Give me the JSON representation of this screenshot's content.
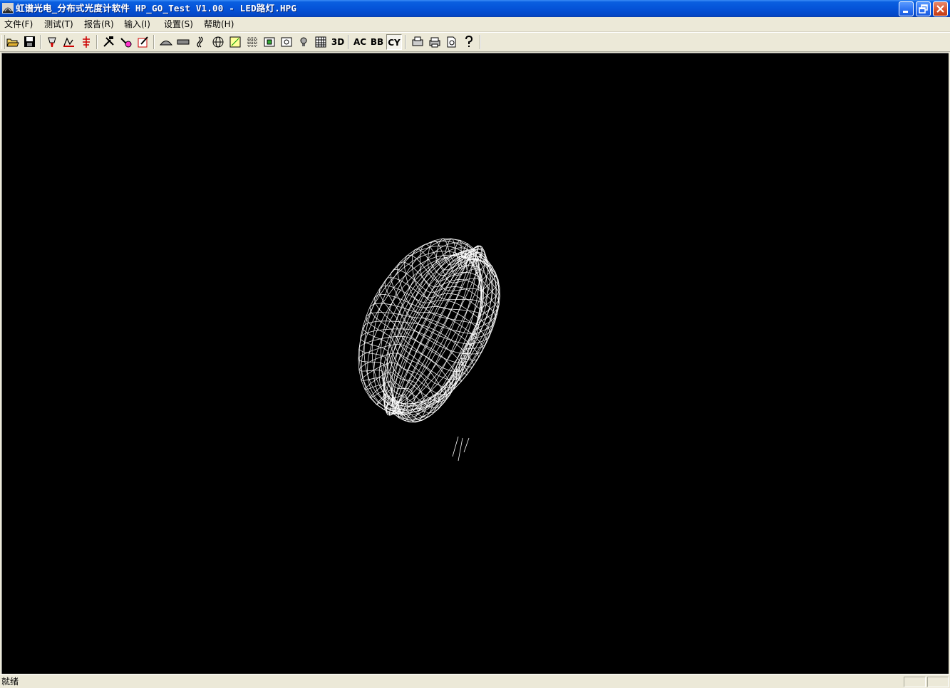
{
  "window": {
    "title": "虹谱光电_分布式光度计软件 HP_GO_Test V1.00 - LED路灯.HPG",
    "app_icon": "photometer-app-icon",
    "controls": [
      "minimize-icon",
      "restore-icon",
      "close-icon"
    ]
  },
  "menu": {
    "items": [
      {
        "label": "文件(F)"
      },
      {
        "label": "测试(T)"
      },
      {
        "label": "报告(R)"
      },
      {
        "label": "输入(I)"
      },
      {
        "label": "设置(S)"
      },
      {
        "label": "帮助(H)"
      }
    ]
  },
  "toolbar": {
    "icons": [
      "open-folder-icon",
      "save-icon",
      "lamp-test-icon",
      "scan-icon",
      "sensor-icon",
      "tools-icon",
      "calibrate-icon",
      "edit-report-icon",
      "luminaire-icon",
      "flat-lamp-icon",
      "tube-lamp-icon",
      "globe-icon",
      "isolux-icon",
      "grid-icon",
      "green-box-icon",
      "circle-box-icon",
      "bulb-icon",
      "table-icon"
    ],
    "text_buttons": {
      "view_3d": "3D",
      "view_ac": "AC",
      "view_bb": "BB",
      "view_cy": "CY"
    },
    "print_icons": [
      "print-setup-icon",
      "print-icon",
      "print-preview-icon",
      "help-icon"
    ],
    "pressed": "view_cy"
  },
  "viewport": {
    "background": "#000000",
    "mesh_color": "#ffffff",
    "content": "3d-light-distribution-wireframe"
  },
  "status": {
    "text": "就绪"
  }
}
